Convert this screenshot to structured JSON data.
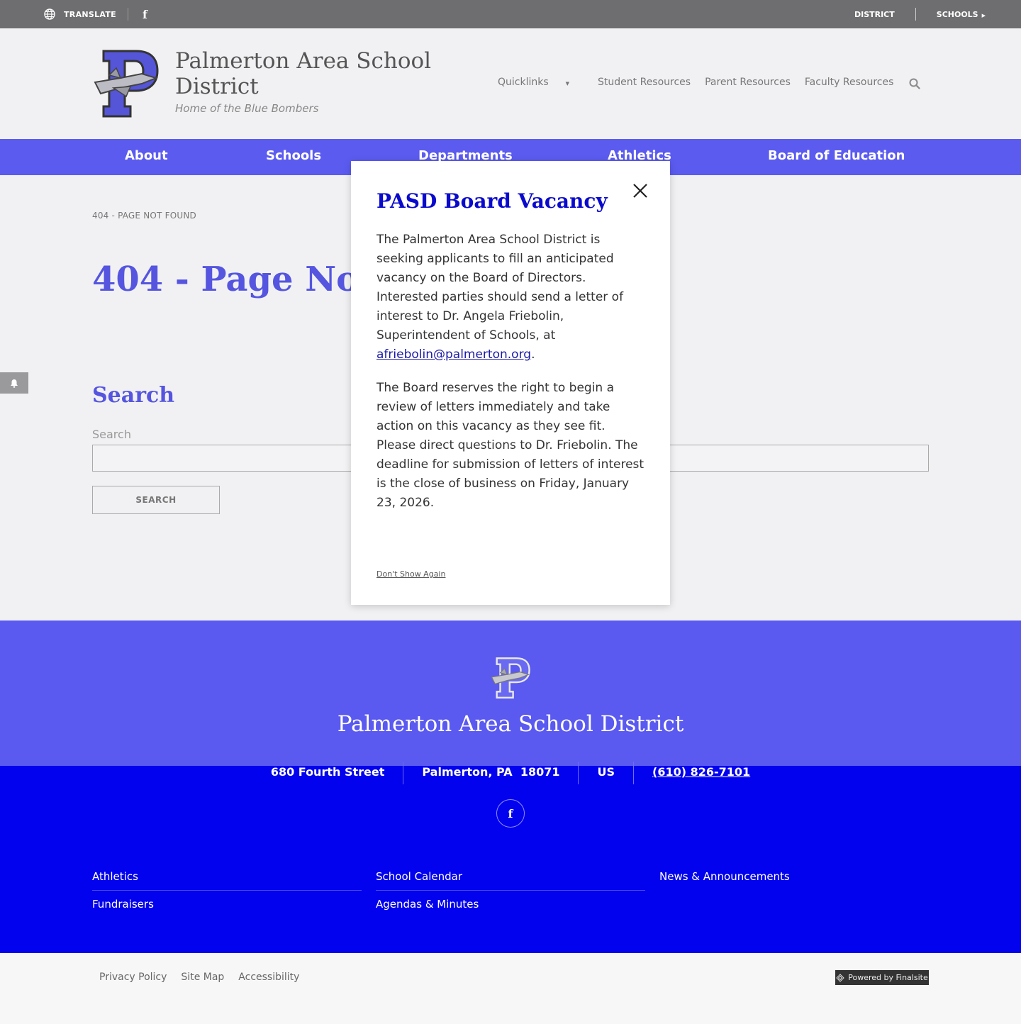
{
  "utility": {
    "translate": "TRANSLATE",
    "facebook": "f",
    "district": "DISTRICT",
    "schools": "SCHOOLS"
  },
  "header": {
    "title": "Palmerton Area School District",
    "tagline": "Home of the Blue Bombers",
    "nav": [
      "Quicklinks",
      "Student Resources",
      "Parent Resources",
      "Faculty Resources"
    ]
  },
  "mainnav": [
    "About",
    "Schools",
    "Departments",
    "Athletics",
    "Board of Education"
  ],
  "content": {
    "breadcrumb": "404 - PAGE NOT FOUND",
    "page_title": "404 - Page Not Found",
    "search_heading": "Search",
    "search_label": "Search",
    "search_value": "",
    "search_button": "SEARCH"
  },
  "modal": {
    "title": "PASD Board Vacancy",
    "p1_text": "The Palmerton Area School District is seeking applicants to fill an anticipated vacancy on the Board of Directors. Interested parties should send a letter of interest to Dr. Angela Friebolin, Superintendent of Schools, at ",
    "p1_link": "afriebolin@palmerton.org",
    "p1_end": ".",
    "p2": "The Board reserves the right to begin a review of letters immediately and take action on this vacancy as they see fit. Please direct questions to Dr. Friebolin. The deadline for submission of letters of interest is the close of business on Friday, January 23, 2026.",
    "dont_show": "Don't Show Again"
  },
  "footer": {
    "name": "Palmerton Area School District",
    "street": "680 Fourth Street",
    "city": "Palmerton, PA  18071",
    "country": "US",
    "phone": "(610) 826-7101",
    "facebook": "f",
    "links": {
      "athletics": "Athletics",
      "calendar": "School Calendar",
      "news": "News & Announcements",
      "fundraisers": "Fundraisers",
      "agendas": "Agendas & Minutes"
    },
    "legal": [
      "Privacy Policy",
      "Site Map",
      "Accessibility"
    ],
    "powered": "Powered by Finalsite"
  },
  "colors": {
    "nav_purple": "#5b5bf0",
    "footer_blue": "#0202ee",
    "heading_purple": "#5555e0",
    "modal_title": "#0a0acc"
  },
  "icons": [
    "globe-icon",
    "facebook-icon",
    "caret-right-icon",
    "caret-down-icon",
    "search-icon",
    "bell-icon",
    "close-icon",
    "finalsite-icon"
  ]
}
